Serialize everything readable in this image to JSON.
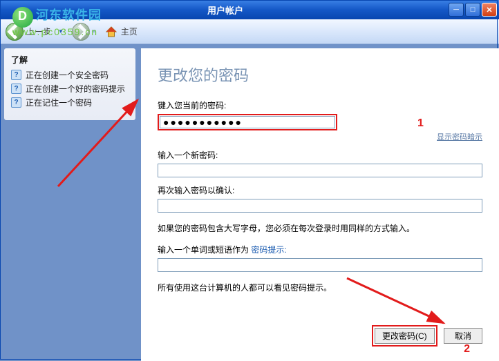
{
  "watermark": {
    "site": "河东软件园",
    "url": "www.pc0359.cn"
  },
  "window": {
    "title": "用户帐户"
  },
  "toolbar": {
    "back": "上一步",
    "home": "主页"
  },
  "sidebar": {
    "heading": "了解",
    "items": [
      {
        "label": "正在创建一个安全密码"
      },
      {
        "label": "正在创建一个好的密码提示"
      },
      {
        "label": "正在记住一个密码"
      }
    ]
  },
  "page": {
    "title": "更改您的密码",
    "current_pw_label": "键入您当前的密码:",
    "current_pw_value": "●●●●●●●●●●●",
    "show_hint": "显示密码暗示",
    "new_pw_label": "输入一个新密码:",
    "confirm_pw_label": "再次输入密码以确认:",
    "caps_warning": "如果您的密码包含大写字母，您必须在每次登录时用同样的方式输入。",
    "hint_field_prefix": "输入一个单词或短语作为",
    "hint_field_suffix": "密码提示:",
    "hint_note": "所有使用这台计算机的人都可以看见密码提示。",
    "submit": "更改密码(C)",
    "cancel": "取消"
  },
  "annotations": {
    "step1": "1",
    "step2": "2"
  }
}
